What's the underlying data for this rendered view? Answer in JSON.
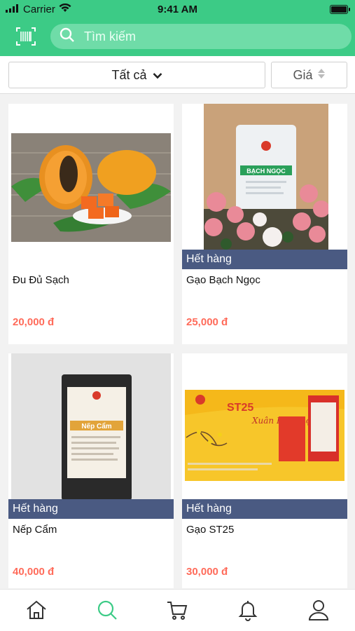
{
  "status_bar": {
    "carrier": "Carrier",
    "time": "9:41 AM"
  },
  "header": {
    "search_placeholder": "Tìm kiếm"
  },
  "filters": {
    "category_label": "Tất cả",
    "price_label": "Giá"
  },
  "products": [
    {
      "name": "Đu Đủ Sạch",
      "price": "20,000 đ",
      "out_of_stock": ""
    },
    {
      "name": "Gạo Bạch Ngọc",
      "price": "25,000 đ",
      "out_of_stock": "Hết hàng"
    },
    {
      "name": "Nếp Cẩm",
      "price": "40,000 đ",
      "out_of_stock": "Hết hàng"
    },
    {
      "name": "Gạo ST25",
      "price": "30,000 đ",
      "out_of_stock": "Hết hàng"
    }
  ],
  "product_images": {
    "bach_ngoc_bag_title": "BẠCH NGỌC",
    "nep_cam_bag_title": "Nếp Cẩm",
    "st25_banner_title": "ST25",
    "st25_banner_script": "Xuân Phúc Lộc"
  },
  "bottom_nav": [
    {
      "icon": "home-icon"
    },
    {
      "icon": "search-icon",
      "active": true
    },
    {
      "icon": "cart-icon"
    },
    {
      "icon": "bell-icon"
    },
    {
      "icon": "user-icon"
    }
  ],
  "colors": {
    "brand": "#3ccb86",
    "price": "#ff6b5a",
    "out_of_stock_bg": "#4a5a82",
    "active_nav": "#3ccb86"
  }
}
